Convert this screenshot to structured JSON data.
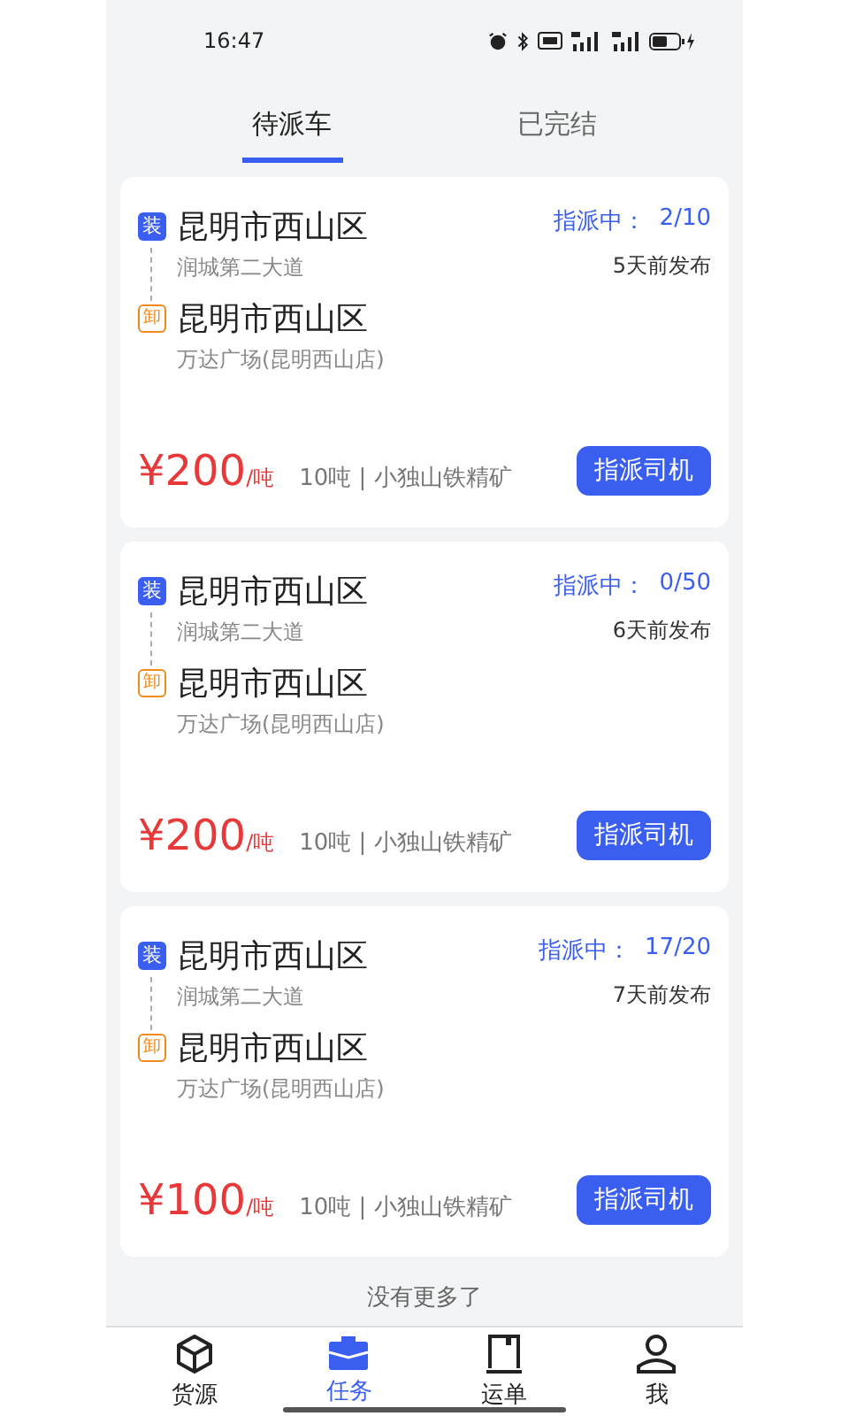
{
  "status_bar": {
    "time": "16:47"
  },
  "tabs": [
    {
      "label": "待派车",
      "selected": true
    },
    {
      "label": "已完结",
      "selected": false
    }
  ],
  "orders": [
    {
      "load": {
        "badge": "装",
        "city": "昆明市西山区",
        "address": "润城第二大道"
      },
      "unload": {
        "badge": "卸",
        "city": "昆明市西山区",
        "address": "万达广场(昆明西山店)"
      },
      "status_label": "指派中：",
      "progress": "2/10",
      "posted": "5天前发布",
      "price": "¥200",
      "unit": "/吨",
      "cargo": "10吨 | 小独山铁精矿",
      "action": "指派司机"
    },
    {
      "load": {
        "badge": "装",
        "city": "昆明市西山区",
        "address": "润城第二大道"
      },
      "unload": {
        "badge": "卸",
        "city": "昆明市西山区",
        "address": "万达广场(昆明西山店)"
      },
      "status_label": "指派中：",
      "progress": "0/50",
      "posted": "6天前发布",
      "price": "¥200",
      "unit": "/吨",
      "cargo": "10吨 | 小独山铁精矿",
      "action": "指派司机"
    },
    {
      "load": {
        "badge": "装",
        "city": "昆明市西山区",
        "address": "润城第二大道"
      },
      "unload": {
        "badge": "卸",
        "city": "昆明市西山区",
        "address": "万达广场(昆明西山店)"
      },
      "status_label": "指派中：",
      "progress": "17/20",
      "posted": "7天前发布",
      "price": "¥100",
      "unit": "/吨",
      "cargo": "10吨 | 小独山铁精矿",
      "action": "指派司机"
    }
  ],
  "end_note": "没有更多了",
  "nav": [
    {
      "kind": "box",
      "label": "货源",
      "selected": false
    },
    {
      "kind": "briefcase",
      "label": "任务",
      "selected": true
    },
    {
      "kind": "waybill",
      "label": "运单",
      "selected": false
    },
    {
      "kind": "person",
      "label": "我",
      "selected": false
    }
  ]
}
